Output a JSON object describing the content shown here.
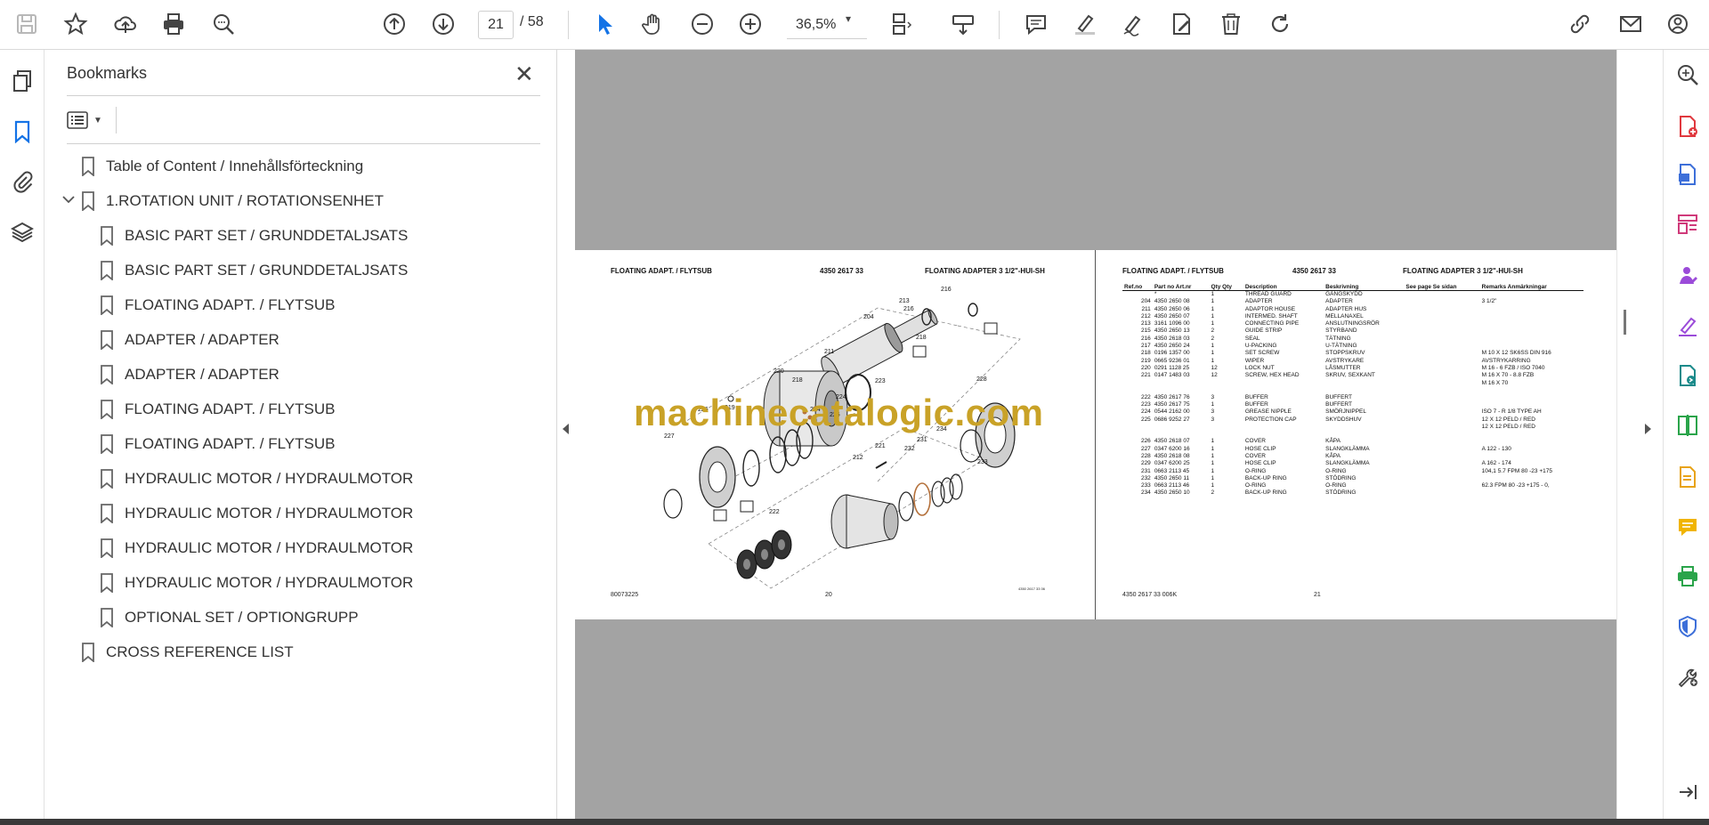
{
  "toolbar": {
    "current_page": "21",
    "total_pages": "/ 58",
    "zoom": "36,5%",
    "zoom_caret": "▾"
  },
  "bookmarks": {
    "title": "Bookmarks",
    "close": "✕",
    "items": [
      {
        "label": "Table of Content / Innehållsförteckning"
      },
      {
        "label": "1.ROTATION UNIT / ROTATIONSENHET"
      },
      {
        "label": "BASIC PART SET / GRUNDDETALJSATS"
      },
      {
        "label": "BASIC PART SET / GRUNDDETALJSATS"
      },
      {
        "label": "FLOATING ADAPT. / FLYTSUB"
      },
      {
        "label": "ADAPTER / ADAPTER"
      },
      {
        "label": "ADAPTER / ADAPTER"
      },
      {
        "label": "FLOATING ADAPT. / FLYTSUB"
      },
      {
        "label": "FLOATING ADAPT. / FLYTSUB"
      },
      {
        "label": "HYDRAULIC MOTOR / HYDRAULMOTOR"
      },
      {
        "label": "HYDRAULIC MOTOR / HYDRAULMOTOR"
      },
      {
        "label": "HYDRAULIC MOTOR / HYDRAULMOTOR"
      },
      {
        "label": "HYDRAULIC MOTOR / HYDRAULMOTOR"
      },
      {
        "label": "OPTIONAL SET / OPTIONGRUPP"
      },
      {
        "label": "CROSS REFERENCE LIST"
      }
    ]
  },
  "left_page": {
    "header_left": "FLOATING ADAPT. / FLYTSUB",
    "header_mid": "4350 2617 33",
    "header_right": "FLOATING ADAPTER 3 1/2\"-HUI-SH",
    "footer_left": "80073225",
    "footer_mid": "20",
    "footer_right": "4350 2617 33 06",
    "callouts": [
      "216",
      "213",
      "204",
      "216",
      "218",
      "211",
      "220",
      "223",
      "218",
      "224",
      "228",
      "226",
      "219",
      "224",
      "225",
      "227",
      "234",
      "231",
      "221",
      "232",
      "212",
      "233",
      "222"
    ]
  },
  "right_page": {
    "header_left": "FLOATING ADAPT. / FLYTSUB",
    "header_mid": "4350 2617 33",
    "header_right": "FLOATING ADAPTER 3 1/2\"-HUI-SH",
    "footer_left": "4350 2617 33 006K",
    "footer_mid": "21",
    "columns": [
      "Ref.no",
      "Part no Art.nr",
      "Qty Qty",
      "Description",
      "Beskrivning",
      "See page Se sidan",
      "Remarks Anmärkningar"
    ],
    "rows": [
      [
        "",
        "*",
        "1",
        "THREAD GUARD",
        "GÄNGSKYDD",
        "",
        ""
      ],
      [
        "204",
        "4350 2650 08",
        "1",
        "ADAPTER",
        "ADAPTER",
        "",
        "3 1/2\""
      ],
      [
        "211",
        "4350 2650 06",
        "1",
        "ADAPTOR HOUSE",
        "ADAPTER HUS",
        "",
        ""
      ],
      [
        "212",
        "4350 2650 07",
        "1",
        "INTERMED. SHAFT",
        "MELLANAXEL",
        "",
        ""
      ],
      [
        "213",
        "3161 1096 00",
        "1",
        "CONNECTING PIPE",
        "ANSLUTNINGSRÖR",
        "",
        ""
      ],
      [
        "215",
        "4350 2650 13",
        "2",
        "GUIDE STRIP",
        "STYRBAND",
        "",
        ""
      ],
      [
        "216",
        "4350 2618 03",
        "2",
        "SEAL",
        "TÄTNING",
        "",
        ""
      ],
      [
        "217",
        "4350 2650 24",
        "1",
        "U-PACKING",
        "U-TÄTNING",
        "",
        ""
      ],
      [
        "218",
        "0196 1357 00",
        "1",
        "SET SCREW",
        "STOPPSKRUV",
        "",
        "M 10 X 12 SK6SS DIN 916"
      ],
      [
        "219",
        "0665 9236 01",
        "1",
        "WIPER",
        "AVSTRYKARE",
        "",
        "AVSTRYKARRING"
      ],
      [
        "220",
        "0291 1128 25",
        "12",
        "LOCK NUT",
        "LÅSMUTTER",
        "",
        "M 16 - 6 FZB / ISO 7040"
      ],
      [
        "221",
        "0147 1483 03",
        "12",
        "SCREW, HEX HEAD",
        "SKRUV, SEXKANT",
        "",
        "M 16 X 70 - 8.8 FZB"
      ],
      [
        "",
        "",
        "",
        "",
        "",
        "",
        "M 16 X 70"
      ],
      [
        "222",
        "4350 2617 76",
        "3",
        "BUFFER",
        "BUFFERT",
        "",
        ""
      ],
      [
        "223",
        "4350 2617 75",
        "1",
        "BUFFER",
        "BUFFERT",
        "",
        ""
      ],
      [
        "224",
        "0544 2162 00",
        "3",
        "GREASE NIPPLE",
        "SMÖRJNIPPEL",
        "",
        "ISO 7 - R 1/8 TYPE AH"
      ],
      [
        "225",
        "0686 9252 27",
        "3",
        "PROTECTION CAP",
        "SKYDDSHUV",
        "",
        "12 X 12 PELD / RED"
      ],
      [
        "",
        "",
        "",
        "",
        "",
        "",
        "12 X 12 PELD / RED"
      ],
      [
        "226",
        "4350 2618 07",
        "1",
        "COVER",
        "KÅPA",
        "",
        ""
      ],
      [
        "227",
        "0347 6200 16",
        "1",
        "HOSE CLIP",
        "SLANGKLÄMMA",
        "",
        "A 122 - 130"
      ],
      [
        "228",
        "4350 2618 08",
        "1",
        "COVER",
        "KÅPA",
        "",
        ""
      ],
      [
        "229",
        "0347 6200 25",
        "1",
        "HOSE CLIP",
        "SLANGKLÄMMA",
        "",
        "A 162 - 174"
      ],
      [
        "231",
        "0663 2113 45",
        "1",
        "O-RING",
        "O-RING",
        "",
        "104,1 5.7 FPM 80 -23 +175"
      ],
      [
        "232",
        "4350 2650 11",
        "1",
        "BACK-UP RING",
        "STÖDRING",
        "",
        ""
      ],
      [
        "233",
        "0663 2113 46",
        "1",
        "O-RING",
        "O-RING",
        "",
        "62.3 FPM 80 -23 +175 - 0,"
      ],
      [
        "234",
        "4350 2650 10",
        "2",
        "BACK-UP RING",
        "STÖDRING",
        "",
        ""
      ]
    ]
  },
  "watermark": "machinecatalogic.com"
}
